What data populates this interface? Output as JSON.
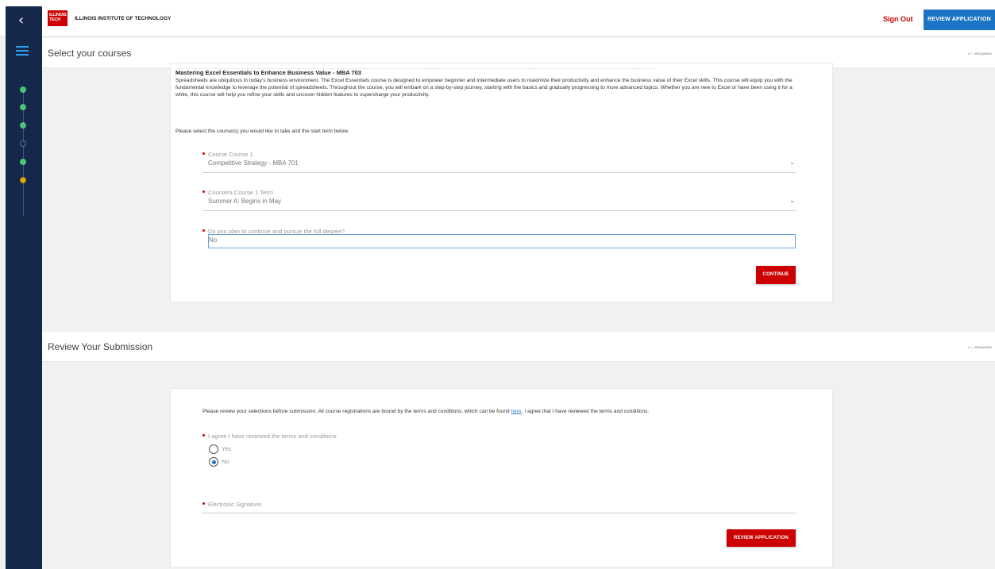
{
  "header": {
    "back_icon": "chevron-left-icon",
    "logo_text": "ILLINOIS TECH",
    "brand": "ILLINOIS INSTITUTE OF TECHNOLOGY",
    "sign_out": "Sign Out",
    "review_application": "REVIEW APPLICATION"
  },
  "sidebar": {
    "menu_icon": "hamburger-menu-icon",
    "steps": [
      "done",
      "done",
      "done",
      "todo",
      "done",
      "current"
    ]
  },
  "select_courses": {
    "title": "Select your courses",
    "required_note": "* = REQUIRED",
    "faded_text": "..................................................................................................................................................................................................................................................................................................",
    "course_title": "Mastering Excel Essentials to Enhance Business Value - MBA 703",
    "course_desc": "Spreadsheets are ubiquitous in today's business environment. The Excel Essentials course is designed to empower beginner and intermediate users to maximize their productivity and enhance the business value of their Excel skills. This course will equip you with the fundamental knowledge to leverage the potential of spreadsheets. Throughout the course, you will embark on a step-by-step journey, starting with the basics and gradually progressing to more advanced topics. Whether you are new to Excel or have been using it for a while, this course will help you refine your skills and uncover hidden features to supercharge your productivity.",
    "prompt": "Please select the course(s) you would like to take and the start term below.",
    "fields": {
      "course1": {
        "label": "Course Course 1",
        "value": "Competitive Strategy - MBA 701"
      },
      "term1": {
        "label": "Coursera Course 1 Term",
        "value": "Summer A: Begins in May"
      },
      "full_degree": {
        "label": "Do you plan to continue and pursue the full degree?",
        "value": "No"
      }
    },
    "continue": "CONTINUE"
  },
  "review": {
    "title": "Review Your Submission",
    "required_note": "* = REQUIRED",
    "text_before": "Please review your selections before submission. All course registrations are bound by the terms and conditions, which can be found ",
    "link": "here",
    "text_after": ". I agree that I have reviewed the terms and conditions.",
    "agree_label": "I agree I have reviewed the terms and conditions",
    "options": [
      "Yes",
      "No"
    ],
    "selected": "No",
    "signature_label": "Electronic Signature",
    "review_button": "REVIEW APPLICATION"
  }
}
